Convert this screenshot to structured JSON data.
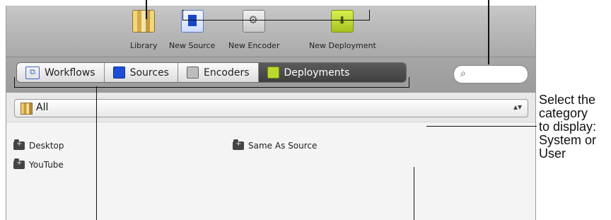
{
  "toolbar": {
    "library": {
      "label": "Library",
      "icon": "library-icon"
    },
    "new_source": {
      "label": "New Source",
      "icon": "new-source-icon"
    },
    "new_encoder": {
      "label": "New Encoder",
      "icon": "new-encoder-icon"
    },
    "new_deployment": {
      "label": "New Deployment",
      "icon": "new-deployment-icon"
    }
  },
  "tabs": [
    {
      "label": "Workflows",
      "icon": "workflows-icon"
    },
    {
      "label": "Sources",
      "icon": "sources-icon"
    },
    {
      "label": "Encoders",
      "icon": "encoders-icon"
    },
    {
      "label": "Deployments",
      "icon": "deployments-icon",
      "active": true
    }
  ],
  "search": {
    "placeholder": "",
    "icon": "search-icon"
  },
  "category_select": {
    "value": "All",
    "icon": "library-icon"
  },
  "items": [
    {
      "label": "Desktop",
      "icon": "folder-icon"
    },
    {
      "label": "YouTube",
      "icon": "folder-icon"
    },
    {
      "label": "Same As Source",
      "icon": "folder-icon"
    }
  ],
  "callout": {
    "category_help": [
      "Select the",
      "category",
      "to display:",
      "System or",
      "User"
    ]
  }
}
